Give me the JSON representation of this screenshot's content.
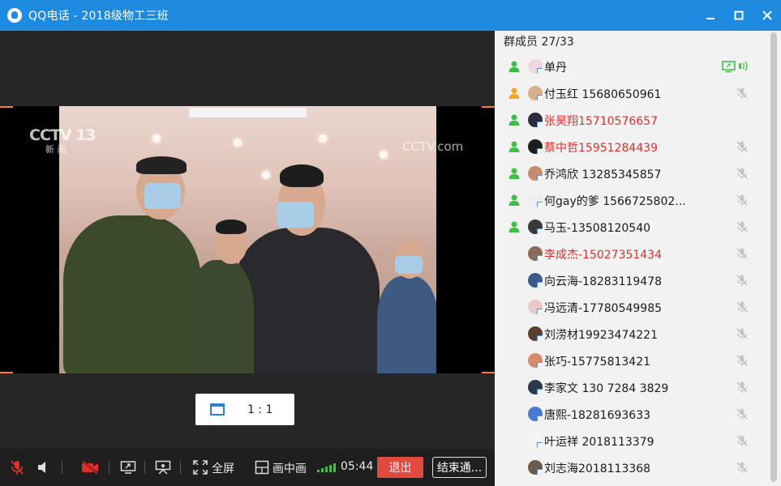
{
  "window": {
    "title": "QQ电话 - 2018级物工三班",
    "app_icon": "qq-penguin-icon",
    "accent_color": "#1e8be0"
  },
  "video": {
    "channel_logo_left": "CCTV 13",
    "channel_logo_sub": "新 闻",
    "channel_logo_right": "CCTV.com",
    "aspect_ratio_label": "1 : 1"
  },
  "toolbar": {
    "mic_icon": "mic-muted-icon",
    "speaker_icon": "speaker-icon",
    "camera_icon": "camera-off-icon",
    "share_icon": "screen-share-icon",
    "whiteboard_icon": "presenter-icon",
    "fullscreen_label": "全屏",
    "pip_label": "画中画",
    "duration": "05:44",
    "exit_label": "退出",
    "end_label": "结束通...",
    "exit_color": "#e04a3f",
    "signal_color": "#3fc43f"
  },
  "members": {
    "header": "群成员 27/33",
    "list": [
      {
        "name": "单丹",
        "highlight": false,
        "role": "member",
        "status": "screen-share-speaking"
      },
      {
        "name": "付玉红 15680650961",
        "highlight": false,
        "role": "admin",
        "status": "muted"
      },
      {
        "name": "张昊翔15710576657",
        "highlight": true,
        "role": "member",
        "status": "none"
      },
      {
        "name": "蔡中哲15951284439",
        "highlight": true,
        "role": "member",
        "status": "muted"
      },
      {
        "name": "乔鸿欣 13285345857",
        "highlight": false,
        "role": "member",
        "status": "muted"
      },
      {
        "name": "何gay的爹 1566725802...",
        "highlight": false,
        "role": "member",
        "status": "muted"
      },
      {
        "name": "马玉-13508120540",
        "highlight": false,
        "role": "member",
        "status": "muted"
      },
      {
        "name": "李成杰-15027351434",
        "highlight": true,
        "role": "none",
        "status": "muted"
      },
      {
        "name": "向云海-18283119478",
        "highlight": false,
        "role": "none",
        "status": "muted"
      },
      {
        "name": "冯远清-17780549985",
        "highlight": false,
        "role": "none",
        "status": "muted"
      },
      {
        "name": "刘涝材19923474221",
        "highlight": false,
        "role": "none",
        "status": "muted"
      },
      {
        "name": "张巧-15775813421",
        "highlight": false,
        "role": "none",
        "status": "muted"
      },
      {
        "name": "李家文  130 7284 3829",
        "highlight": false,
        "role": "none",
        "status": "muted"
      },
      {
        "name": "唐熙-18281693633",
        "highlight": false,
        "role": "none",
        "status": "muted"
      },
      {
        "name": "叶运祥  2018113379",
        "highlight": false,
        "role": "none",
        "status": "muted"
      },
      {
        "name": "刘志海2018113368",
        "highlight": false,
        "role": "none",
        "status": "muted"
      }
    ]
  }
}
